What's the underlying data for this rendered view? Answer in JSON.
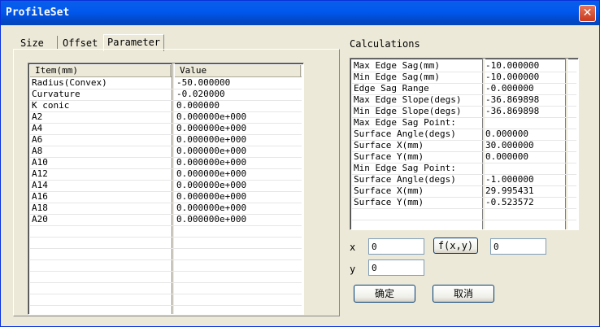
{
  "window": {
    "title": "ProfileSet"
  },
  "tabs": [
    {
      "label": "Size"
    },
    {
      "label": "Offset"
    },
    {
      "label": "Parameter"
    }
  ],
  "param_table": {
    "headers": [
      "Item(mm)",
      "Value"
    ],
    "rows": [
      [
        "Radius(Convex)",
        "-50.000000"
      ],
      [
        "Curvature",
        "-0.020000"
      ],
      [
        "K conic",
        "0.000000"
      ],
      [
        "A2",
        "0.000000e+000"
      ],
      [
        "A4",
        "0.000000e+000"
      ],
      [
        "A6",
        "0.000000e+000"
      ],
      [
        "A8",
        "0.000000e+000"
      ],
      [
        "A10",
        "0.000000e+000"
      ],
      [
        "A12",
        "0.000000e+000"
      ],
      [
        "A14",
        "0.000000e+000"
      ],
      [
        "A16",
        "0.000000e+000"
      ],
      [
        "A18",
        "0.000000e+000"
      ],
      [
        "A20",
        "0.000000e+000"
      ]
    ]
  },
  "calculations": {
    "label": "Calculations",
    "rows": [
      [
        "Max Edge Sag(mm)",
        "-10.000000"
      ],
      [
        "Min Edge Sag(mm)",
        "-10.000000"
      ],
      [
        "Edge Sag Range",
        "-0.000000"
      ],
      [
        "Max Edge Slope(degs)",
        "-36.869898"
      ],
      [
        "Min Edge Slope(degs)",
        "-36.869898"
      ],
      [
        "Max Edge Sag Point:",
        ""
      ],
      [
        "Surface Angle(degs)",
        "0.000000"
      ],
      [
        "Surface X(mm)",
        "30.000000"
      ],
      [
        "Surface Y(mm)",
        "0.000000"
      ],
      [
        "Min Edge Sag Point:",
        ""
      ],
      [
        "Surface Angle(degs)",
        "-1.000000"
      ],
      [
        "Surface X(mm)",
        "29.995431"
      ],
      [
        "Surface Y(mm)",
        "-0.523572"
      ]
    ]
  },
  "fx": {
    "x_label": "x",
    "x_value": "0",
    "y_label": "y",
    "y_value": "0",
    "button_label": "f(x,y)",
    "result_value": "0"
  },
  "buttons": {
    "ok": "确定",
    "cancel": "取消"
  }
}
